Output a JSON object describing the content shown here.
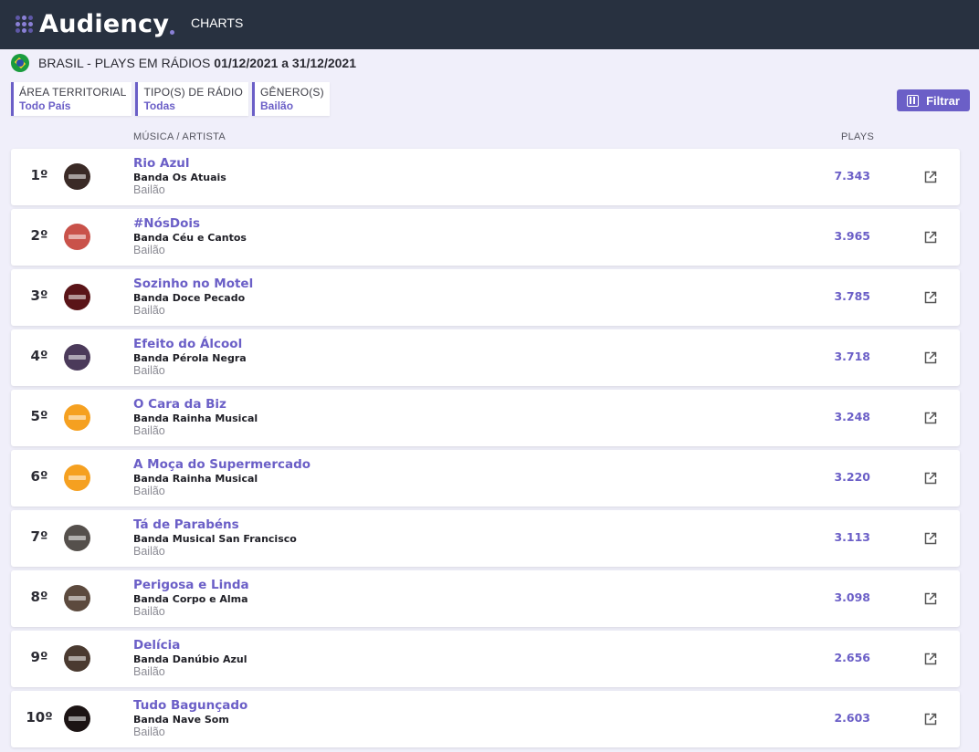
{
  "header": {
    "logo_text": "Audiency",
    "nav_charts": "CHARTS"
  },
  "title": {
    "country_flag": "brazil-flag-icon",
    "main": "BRASIL - PLAYS EM RÁDIOS",
    "range": "01/12/2021 a 31/12/2021"
  },
  "filters": [
    {
      "label": "ÁREA TERRITORIAL",
      "value": "Todo País"
    },
    {
      "label": "TIPO(S) DE RÁDIO",
      "value": "Todas"
    },
    {
      "label": "GÊNERO(S)",
      "value": "Bailão"
    }
  ],
  "filter_button": {
    "label": "Filtrar",
    "icon": "sliders-icon"
  },
  "columns": {
    "music_artist": "MÚSICA / ARTISTA",
    "plays": "PLAYS"
  },
  "colors": {
    "accent": "#6b5fc7",
    "header_bg": "#283140",
    "page_bg": "#f0effa"
  },
  "rows": [
    {
      "rank": "1º",
      "song": "Rio Azul",
      "artist": "Banda Os Atuais",
      "genre": "Bailão",
      "plays": "7.343",
      "art_color": "#3a2a26"
    },
    {
      "rank": "2º",
      "song": "#NósDois",
      "artist": "Banda Céu e Cantos",
      "genre": "Bailão",
      "plays": "3.965",
      "art_color": "#c9524a"
    },
    {
      "rank": "3º",
      "song": "Sozinho no Motel",
      "artist": "Banda Doce Pecado",
      "genre": "Bailão",
      "plays": "3.785",
      "art_color": "#5a1418"
    },
    {
      "rank": "4º",
      "song": "Efeito do Álcool",
      "artist": "Banda Pérola Negra",
      "genre": "Bailão",
      "plays": "3.718",
      "art_color": "#4b3a5a"
    },
    {
      "rank": "5º",
      "song": "O Cara da Biz",
      "artist": "Banda Rainha Musical",
      "genre": "Bailão",
      "plays": "3.248",
      "art_color": "#f5a020"
    },
    {
      "rank": "6º",
      "song": "A Moça do Supermercado",
      "artist": "Banda Rainha Musical",
      "genre": "Bailão",
      "plays": "3.220",
      "art_color": "#f5a020"
    },
    {
      "rank": "7º",
      "song": "Tá de Parabéns",
      "artist": "Banda Musical San Francisco",
      "genre": "Bailão",
      "plays": "3.113",
      "art_color": "#55504c"
    },
    {
      "rank": "8º",
      "song": "Perigosa e Linda",
      "artist": "Banda Corpo e Alma",
      "genre": "Bailão",
      "plays": "3.098",
      "art_color": "#5c4a3e"
    },
    {
      "rank": "9º",
      "song": "Delícia",
      "artist": "Banda Danúbio Azul",
      "genre": "Bailão",
      "plays": "2.656",
      "art_color": "#4a3a30"
    },
    {
      "rank": "10º",
      "song": "Tudo Bagunçado",
      "artist": "Banda Nave Som",
      "genre": "Bailão",
      "plays": "2.603",
      "art_color": "#1c1414"
    }
  ]
}
